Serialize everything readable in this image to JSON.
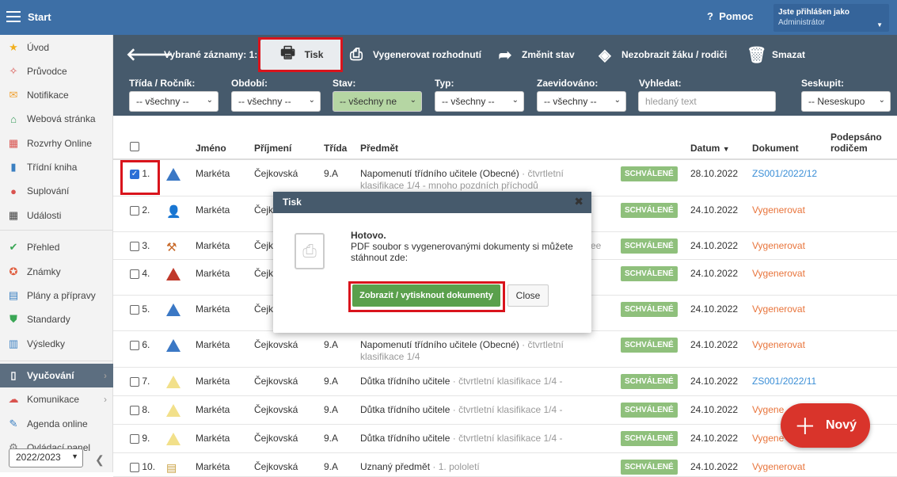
{
  "topbar": {
    "start": "Start",
    "help": "Pomoc",
    "user_line1": "Jste přihlášen jako",
    "user_line2": "Administrátor"
  },
  "sidebar": {
    "items": [
      {
        "label": "Úvod",
        "icon": "star-icon",
        "color": "#f2b01e"
      },
      {
        "label": "Průvodce",
        "icon": "wand-icon",
        "color": "#d9534f"
      },
      {
        "label": "Notifikace",
        "icon": "envelope-icon",
        "color": "#f0a030"
      },
      {
        "label": "Webová stránka",
        "icon": "home-icon",
        "color": "#3a9d5d"
      },
      {
        "label": "Rozvrhy Online",
        "icon": "calendar-icon",
        "color": "#d9534f"
      },
      {
        "label": "Třídní kniha",
        "icon": "book-icon",
        "color": "#3a7fc1"
      },
      {
        "label": "Suplování",
        "icon": "person-icon",
        "color": "#d9534f"
      },
      {
        "label": "Události",
        "icon": "calendar-dark-icon",
        "color": "#444"
      },
      {
        "label": "Přehled",
        "icon": "check-circle-icon",
        "color": "#3aa655"
      },
      {
        "label": "Známky",
        "icon": "grade-icon",
        "color": "#e05a3a"
      },
      {
        "label": "Plány a přípravy",
        "icon": "briefcase-icon",
        "color": "#3a7fc1"
      },
      {
        "label": "Standardy",
        "icon": "shield-icon",
        "color": "#3aa655"
      },
      {
        "label": "Výsledky",
        "icon": "bar-chart-icon",
        "color": "#3a7fc1"
      },
      {
        "label": "Vyučování",
        "icon": "open-book-icon",
        "color": "#fff"
      },
      {
        "label": "Komunikace",
        "icon": "chat-icon",
        "color": "#d9534f"
      },
      {
        "label": "Agenda online",
        "icon": "pen-icon",
        "color": "#3a7fc1"
      },
      {
        "label": "Ovládací panel",
        "icon": "gear-icon",
        "color": "#777"
      }
    ],
    "year": "2022/2023"
  },
  "toolbar": {
    "selected": "Vybrané záznamy: 1:",
    "print": "Tisk",
    "generate": "Vygenerovat rozhodnutí",
    "change": "Změnit stav",
    "hide": "Nezobrazit žáku / rodiči",
    "delete": "Smazat"
  },
  "filters": [
    {
      "label": "Třída / Ročník:",
      "value": "-- všechny --"
    },
    {
      "label": "Období:",
      "value": "-- všechny --"
    },
    {
      "label": "Stav:",
      "value": "-- všechny ne"
    },
    {
      "label": "Typ:",
      "value": "-- všechny --"
    },
    {
      "label": "Zaevidováno:",
      "value": "-- všechny --"
    },
    {
      "label": "Vyhledat:",
      "placeholder": "hledaný text"
    },
    {
      "label": "Seskupit:",
      "value": "-- Neseskupo"
    }
  ],
  "table": {
    "headers": {
      "name": "Jméno",
      "surname": "Příjmení",
      "cls": "Třída",
      "subject": "Předmět",
      "date": "Datum",
      "doc": "Dokument",
      "signed": "Podepsáno rodičem"
    },
    "rows": [
      {
        "n": "1.",
        "checked": true,
        "name": "Markéta",
        "surname": "Čejkovská",
        "cls": "9.A",
        "subject": "Napomenutí třídního učitele (Obecné)",
        "detail": "· čtvrtletní",
        "detail2": "klasifikace 1/4 - mnoho pozdních příchodů",
        "status": "SCHVÁLENÉ",
        "date": "28.10.2022",
        "doc": "ZS001/2022/12",
        "doctype": "link"
      },
      {
        "n": "2.",
        "name": "Markéta",
        "surname": "Čejk",
        "cls": "",
        "subject": "",
        "status": "SCHVÁLENÉ",
        "date": "24.10.2022",
        "doc": "Vygenerovat",
        "doctype": "gen"
      },
      {
        "n": "3.",
        "name": "Markéta",
        "surname": "Čejk",
        "cls": "",
        "subject": "",
        "trail": "ee",
        "status": "SCHVÁLENÉ",
        "date": "24.10.2022",
        "doc": "Vygenerovat",
        "doctype": "gen"
      },
      {
        "n": "4.",
        "name": "Markéta",
        "surname": "Čejk",
        "cls": "",
        "subject": "",
        "status": "SCHVÁLENÉ",
        "date": "24.10.2022",
        "doc": "Vygenerovat",
        "doctype": "gen"
      },
      {
        "n": "5.",
        "name": "Markéta",
        "surname": "Čejk",
        "cls": "",
        "subject": "",
        "status": "SCHVÁLENÉ",
        "date": "24.10.2022",
        "doc": "Vygenerovat",
        "doctype": "gen"
      },
      {
        "n": "6.",
        "name": "Markéta",
        "surname": "Čejkovská",
        "cls": "9.A",
        "subject": "Napomenutí třídního učitele (Obecné)",
        "detail": "· čtvrtletní",
        "detail2": "klasifikace 1/4",
        "status": "SCHVÁLENÉ",
        "date": "24.10.2022",
        "doc": "Vygenerovat",
        "doctype": "gen"
      },
      {
        "n": "7.",
        "name": "Markéta",
        "surname": "Čejkovská",
        "cls": "9.A",
        "subject": "Důtka třídního učitele",
        "detail": "· čtvrtletní klasifikace 1/4 -",
        "status": "SCHVÁLENÉ",
        "date": "24.10.2022",
        "doc": "ZS001/2022/11",
        "doctype": "link"
      },
      {
        "n": "8.",
        "name": "Markéta",
        "surname": "Čejkovská",
        "cls": "9.A",
        "subject": "Důtka třídního učitele",
        "detail": "· čtvrtletní klasifikace 1/4 -",
        "status": "SCHVÁLENÉ",
        "date": "24.10.2022",
        "doc": "Vygene",
        "doctype": "gen"
      },
      {
        "n": "9.",
        "name": "Markéta",
        "surname": "Čejkovská",
        "cls": "9.A",
        "subject": "Důtka třídního učitele",
        "detail": "· čtvrtletní klasifikace 1/4 -",
        "status": "SCHVÁLENÉ",
        "date": "24.10.2022",
        "doc": "Vygene",
        "doctype": "gen"
      },
      {
        "n": "10.",
        "name": "Markéta",
        "surname": "Čejkovská",
        "cls": "9.A",
        "subject": "Uznaný předmět",
        "detail": "· 1. pololetí",
        "status": "SCHVÁLENÉ",
        "date": "24.10.2022",
        "doc": "Vygenerovat",
        "doctype": "gen"
      }
    ]
  },
  "dialog": {
    "title": "Tisk",
    "done": "Hotovo.",
    "message": "PDF soubor s vygenerovanými dokumenty si můžete stáhnout zde:",
    "primary": "Zobrazit / vytisknout dokumenty",
    "close": "Close"
  },
  "fab": {
    "label": "Nový"
  }
}
